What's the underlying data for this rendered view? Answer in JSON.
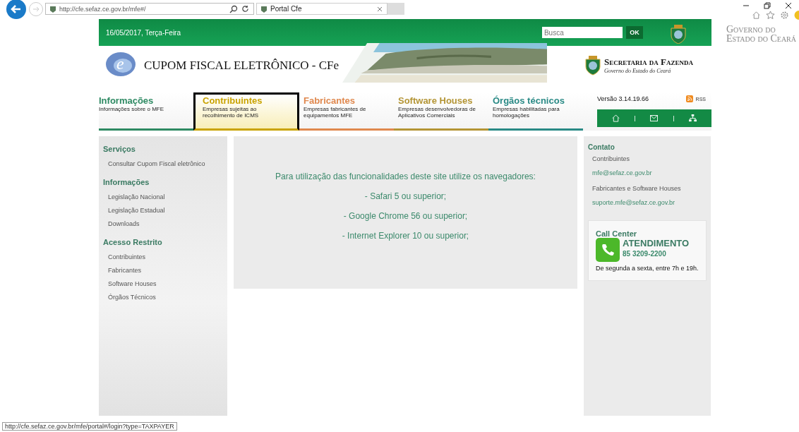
{
  "browser": {
    "address": "http://cfe.sefaz.ce.gov.br/mfe#/",
    "tab": {
      "label": "Portal Cfe"
    }
  },
  "topbar": {
    "date": "16/05/2017, Terça-Feira",
    "search": {
      "placeholder": "Busca"
    },
    "search_button": "OK",
    "gov_lines": [
      "Governo do",
      "Estado do Ceará"
    ]
  },
  "banner": {
    "title": "CUPOM FISCAL ELETRÔNICO - CFe",
    "logo": "e",
    "secretaria": "Secretaria da Fazenda",
    "secretaria_sub": "Governo do Estado do Ceará"
  },
  "nav": [
    {
      "title": "Informações",
      "subtitle": "Informações sobre o MFE",
      "color": "#2e8a63",
      "selected": false
    },
    {
      "title": "Contribuintes",
      "subtitle": "Empresas sujeitas ao recolhimento de ICMS",
      "color": "#c9a300",
      "selected": true
    },
    {
      "title": "Fabricantes",
      "subtitle": "Empresas fabricantes de equipamentos MFE",
      "color": "#e0884e",
      "selected": false
    },
    {
      "title": "Software Houses",
      "subtitle": "Empresas desenvolvedoras de Aplicativos Comerciais",
      "color": "#b49535",
      "selected": false
    },
    {
      "title": "Órgãos técnicos",
      "subtitle": "Empresas habilitadas para homologações",
      "color": "#2a8a86",
      "selected": false
    }
  ],
  "version": "Versão 3.14.19.66",
  "rss": "RSS",
  "sidebar": [
    {
      "heading": "Serviços",
      "items": [
        "Consultar Cupom Fiscal eletrônico"
      ]
    },
    {
      "heading": "Informações",
      "items": [
        "Legislação Nacional",
        "Legislação Estadual",
        "Downloads"
      ]
    },
    {
      "heading": "Acesso Restrito",
      "items": [
        "Contribuintes",
        "Fabricantes",
        "Software Houses",
        "Órgãos Técnicos"
      ]
    }
  ],
  "notice": {
    "intro": "Para utilização das funcionalidades deste site utilize os navegadores:",
    "browsers": [
      "- Safari 5 ou superior;",
      "- Google Chrome 56 ou superior;",
      "- Internet Explorer 10 ou superior;"
    ]
  },
  "contact": {
    "heading": "Contato",
    "groups": [
      {
        "label": "Contribuintes",
        "email": "mfe@sefaz.ce.gov.br"
      },
      {
        "label": "Fabricantes e Software Houses",
        "email": "suporte.mfe@sefaz.ce.gov.br"
      }
    ]
  },
  "call_center": {
    "title": "Call Center",
    "headline": "ATENDIMENTO",
    "phone": "85 3209-2200",
    "hours": "De segunda a sexta, entre 7h e 19h."
  },
  "status_url": "http://cfe.sefaz.ce.gov.br/mfe/portal#/login?type=TAXPAYER"
}
